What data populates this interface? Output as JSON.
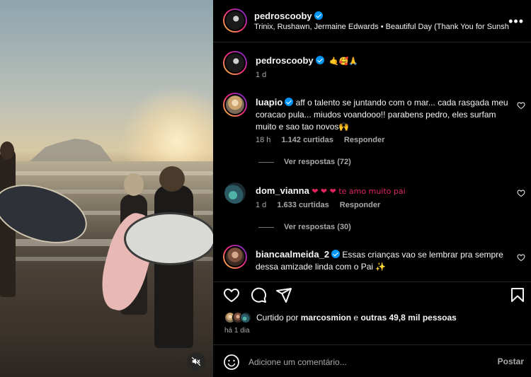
{
  "post": {
    "author": "pedroscooby",
    "subline": "Trinix, Rushawn, Jermaine Edwards • Beautiful Day (Thank You for Sunshi",
    "caption_emojis": "🤙🥰🙏",
    "caption_time": "1 d"
  },
  "comments": [
    {
      "username": "luapio",
      "verified": true,
      "text": "aff o talento se juntando com o mar... cada rasgada meu coracao pula... miudos voandooo!! parabens pedro, eles surfam muito e sao tao novos🙌",
      "time": "18 h",
      "likes": "1.142 curtidas",
      "reply": "Responder",
      "replies": "Ver respostas (72)"
    },
    {
      "username": "dom_vianna",
      "verified": false,
      "text": "❤ ❤ ❤ te amo muito pai",
      "time": "1 d",
      "likes": "1.633 curtidas",
      "reply": "Responder",
      "replies": "Ver respostas (30)"
    },
    {
      "username": "biancaalmeida_2",
      "verified": true,
      "text": "Essas crianças vao se lembrar pra sempre dessa amizade linda com o Pai ✨",
      "time": "",
      "likes": "",
      "reply": "",
      "replies": ""
    }
  ],
  "likes_bar": {
    "prefix": "Curtido por",
    "user": "marcosmion",
    "connector": "e",
    "others": "outras 49,8 mil pessoas"
  },
  "time_ago": "há 1 dia",
  "comment_box": {
    "placeholder": "Adicione um comentário...",
    "post_label": "Postar"
  },
  "icons": {
    "more": "more-options-icon",
    "like": "heart-icon",
    "comment": "comment-icon",
    "share": "share-icon",
    "save": "bookmark-icon",
    "emoji": "emoji-icon",
    "mute": "muted-speaker-icon"
  },
  "colors": {
    "verified": "#0095f6",
    "heart_emoji": "#e0245e",
    "muted_text": "#a8a8a8"
  }
}
